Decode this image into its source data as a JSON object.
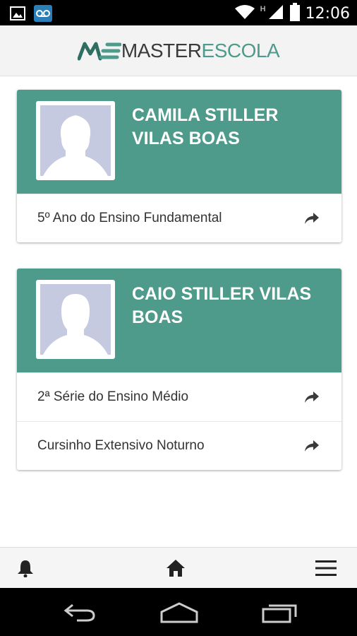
{
  "status_bar": {
    "time": "12:06",
    "network_label": "H",
    "icons": [
      "image-notification-icon",
      "voicemail-icon",
      "wifi-icon",
      "signal-icon",
      "battery-icon"
    ]
  },
  "header": {
    "logo_mark": "ME",
    "logo_text_1": "MASTER",
    "logo_text_2": "ESCOLA"
  },
  "students": [
    {
      "name": "CAMILA STILLER VILAS BOAS",
      "courses": [
        "5º Ano do Ensino Fundamental"
      ]
    },
    {
      "name": "CAIO STILLER VILAS BOAS",
      "courses": [
        "2ª Série do Ensino Médio",
        "Cursinho Extensivo Noturno"
      ]
    }
  ],
  "bottom_nav": {
    "items": [
      "notifications",
      "home",
      "menu"
    ]
  },
  "colors": {
    "accent": "#4e9a8b",
    "avatar_placeholder": "#c5cae1"
  }
}
